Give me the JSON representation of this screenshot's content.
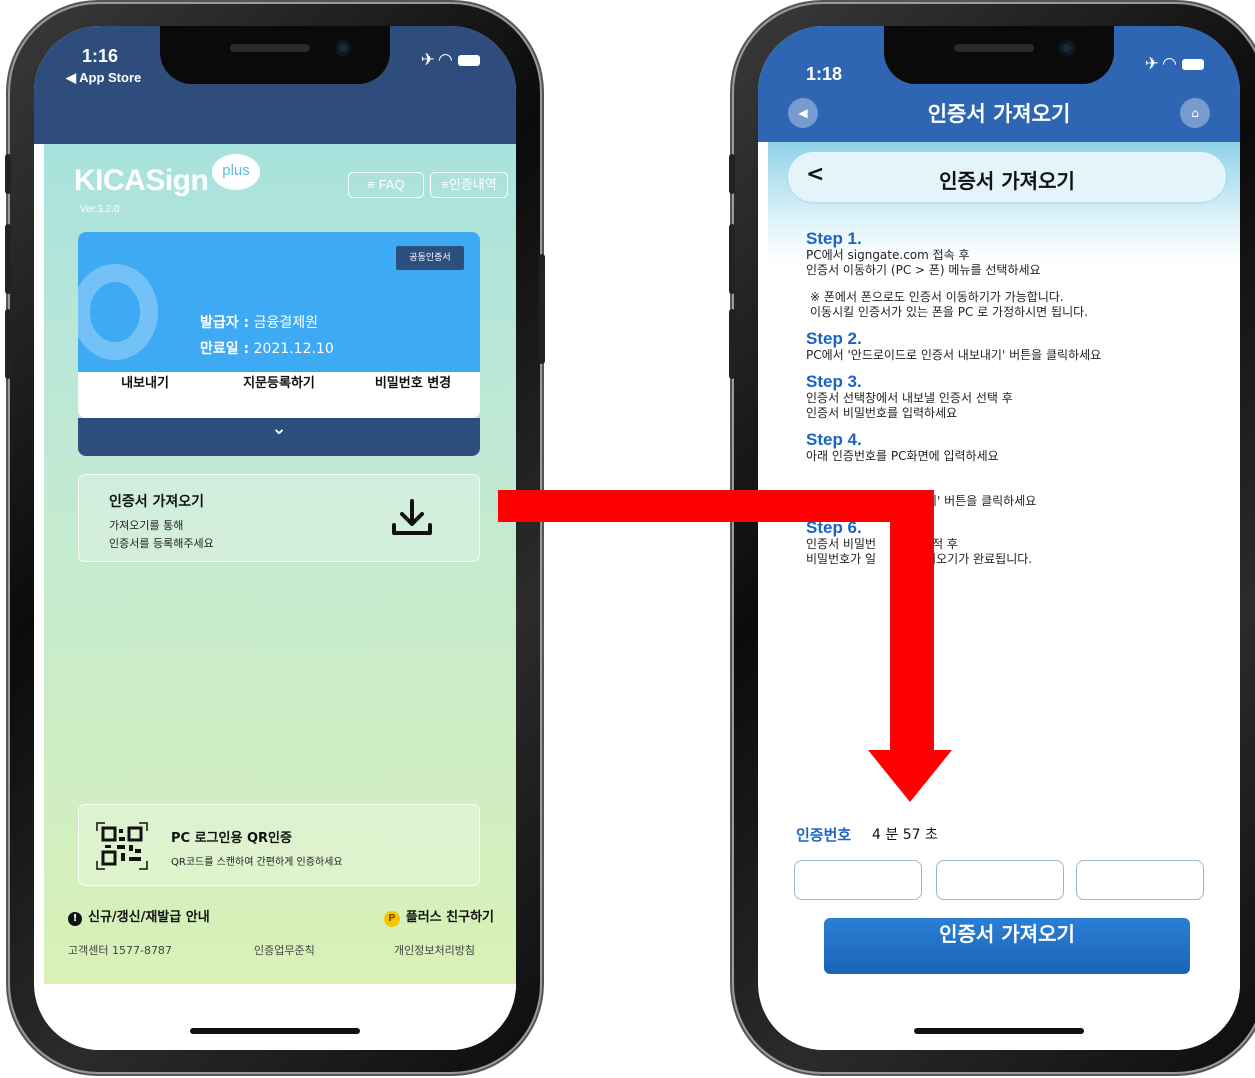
{
  "left_phone": {
    "status": {
      "time": "1:16",
      "back_app": "◀ App Store"
    },
    "header": {
      "logo": "KICASign",
      "logo_badge": "plus",
      "version": "Ver.3.2.0",
      "faq_button": "≡ FAQ",
      "history_button": "≡인증내역"
    },
    "certificate": {
      "badge": "공동인증서",
      "issuer_label": "발급자 :",
      "issuer_value": "금융결제원",
      "expire_label": "만료일 :",
      "expire_value": "2021.12.10",
      "actions": [
        "내보내기",
        "지문등록하기",
        "비밀번호 변경"
      ],
      "expand_icon": "chevron-down-icon"
    },
    "import_card": {
      "title": "인증서 가져오기",
      "desc_line1": "가져오기를 통해",
      "desc_line2": "인증서를 등록해주세요",
      "icon": "download-icon"
    },
    "qr_card": {
      "title": "PC 로그인용 QR인증",
      "desc": "QR코드를 스캔하여 간편하게 인증하세요"
    },
    "bottom": {
      "notice": "신규/갱신/재발급 안내",
      "friend": "플러스 친구하기",
      "friend_icon": "P",
      "links": [
        "고객센터 1577-8787",
        "인증업무준칙",
        "개인정보처리방침"
      ]
    }
  },
  "right_phone": {
    "status": {
      "time": "1:18"
    },
    "nav_title": "인증서 가져오기",
    "page_title": "인증서 가져오기",
    "steps": [
      {
        "title": "Step 1.",
        "lines": [
          "PC에서 signgate.com 접속 후",
          "인증서 이동하기 (PC > 폰) 메뉴를 선택하세요"
        ]
      },
      {
        "title": "Step 2.",
        "lines": [
          "PC에서 '안드로이드로 인증서 내보내기' 버튼을 클릭하세요"
        ]
      },
      {
        "title": "Step 3.",
        "lines": [
          "인증서 선택창에서 내보낼 인증서 선택 후",
          "인증서 비밀번호를 입력하세요"
        ]
      },
      {
        "title": "Step 4.",
        "lines": [
          "아래 인증번호를 PC화면에 입력하세요"
        ]
      },
      {
        "title": "",
        "lines": [
          "기' 버튼을 클릭하세요"
        ]
      },
      {
        "title": "Step 6.",
        "lines": [
          "인증서 비밀번",
          "비밀번호가 일",
          "적 후",
          "가져오기가 완료됩니다."
        ]
      }
    ],
    "note_line1": "※ 폰에서 폰으로도 인증서 이동하기가 가능합니다.",
    "note_line2": "이동시킬 인증서가 있는 폰을 PC 로 가정하시면 됩니다.",
    "otp_label": "인증번호",
    "otp_timer": "4 분 57 초",
    "import_button": "인증서 가져오기"
  },
  "colors": {
    "left_header": "#2f4d7c",
    "right_header": "#2e66b4",
    "card_blue": "#3eaaf3",
    "step_blue": "#1b64c4",
    "arrow": "#ff0000"
  }
}
